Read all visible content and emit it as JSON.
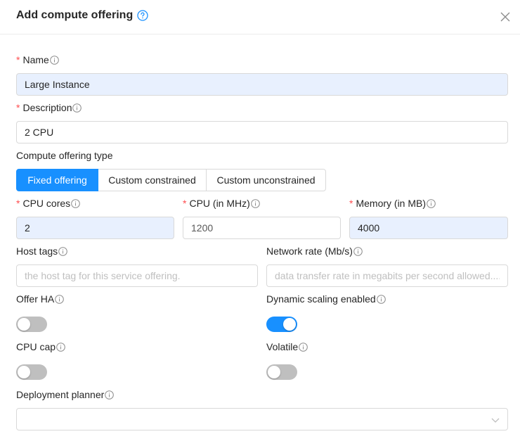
{
  "dialog": {
    "title": "Add compute offering"
  },
  "icons": {
    "help": "question-circle-icon",
    "close": "close-icon",
    "info": "info-circle-icon",
    "dropdown": "chevron-down-icon"
  },
  "colors": {
    "primary": "#1890ff",
    "required": "#ff4d4f",
    "autofill_bg": "#e8f0fe"
  },
  "form": {
    "name": {
      "label": "Name",
      "required": true,
      "value": "Large Instance"
    },
    "description": {
      "label": "Description",
      "required": true,
      "value": "2 CPU"
    },
    "offering_type": {
      "label": "Compute offering type",
      "options": [
        "Fixed offering",
        "Custom constrained",
        "Custom unconstrained"
      ],
      "selected": "Fixed offering"
    },
    "cpu_cores": {
      "label": "CPU cores",
      "required": true,
      "value": "2"
    },
    "cpu_mhz": {
      "label": "CPU (in MHz)",
      "required": true,
      "value": "1200"
    },
    "memory": {
      "label": "Memory (in MB)",
      "required": true,
      "value": "4000"
    },
    "host_tags": {
      "label": "Host tags",
      "placeholder": "the host tag for this service offering."
    },
    "network_rate": {
      "label": "Network rate (Mb/s)",
      "placeholder": "data transfer rate in megabits per second allowed...."
    },
    "offer_ha": {
      "label": "Offer HA",
      "enabled": false
    },
    "dynamic_scaling": {
      "label": "Dynamic scaling enabled",
      "enabled": true
    },
    "cpu_cap": {
      "label": "CPU cap",
      "enabled": false
    },
    "volatile": {
      "label": "Volatile",
      "enabled": false
    },
    "deployment_planner": {
      "label": "Deployment planner",
      "value": ""
    }
  }
}
